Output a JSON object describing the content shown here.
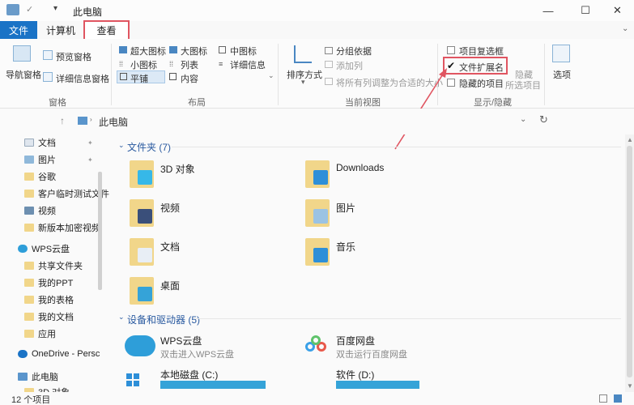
{
  "window": {
    "title": "此电脑",
    "minimize": "—",
    "maximize": "☐",
    "close": "✕"
  },
  "tabs": {
    "file": "文件",
    "computer": "计算机",
    "view": "查看"
  },
  "ribbon": {
    "nav_pane": "导航窗格",
    "preview_pane": "预览窗格",
    "details_pane": "详细信息窗格",
    "layout": {
      "extra_large": "超大图标",
      "large": "大图标",
      "medium": "中图标",
      "small": "小图标",
      "list": "列表",
      "details": "详细信息",
      "tiles": "平铺",
      "content": "内容"
    },
    "sort_by": "排序方式",
    "group_by": "分组依据",
    "add_columns": "添加列",
    "fit_columns": "将所有列调整为合适的大小",
    "show_hide": {
      "item_checkboxes": "项目复选框",
      "file_extensions": "文件扩展名",
      "hidden_items": "隐藏的项目",
      "hide_selected_1": "隐藏",
      "hide_selected_2": "所选项目",
      "file_ext_checked": true
    },
    "options": "选项",
    "groups": {
      "panes": "窗格",
      "layout": "布局",
      "current_view": "当前视图",
      "show_hide": "显示/隐藏"
    }
  },
  "address": {
    "path": "此电脑"
  },
  "nav": {
    "items": [
      {
        "label": "文档",
        "pinned": true
      },
      {
        "label": "图片",
        "pinned": true
      },
      {
        "label": "谷歌"
      },
      {
        "label": "客户临时测试文件"
      },
      {
        "label": "视频"
      },
      {
        "label": "新版本加密视频"
      },
      {
        "label": "WPS云盘"
      },
      {
        "label": "共享文件夹"
      },
      {
        "label": "我的PPT"
      },
      {
        "label": "我的表格"
      },
      {
        "label": "我的文档"
      },
      {
        "label": "应用"
      },
      {
        "label": "OneDrive - Persc"
      },
      {
        "label": "此电脑"
      },
      {
        "label": "3D 对象"
      }
    ]
  },
  "main": {
    "folders_header": "文件夹 (7)",
    "folders": [
      {
        "label": "3D 对象"
      },
      {
        "label": "Downloads"
      },
      {
        "label": "视频"
      },
      {
        "label": "图片"
      },
      {
        "label": "文档"
      },
      {
        "label": "音乐"
      },
      {
        "label": "桌面"
      }
    ],
    "devices_header": "设备和驱动器 (5)",
    "devices": [
      {
        "label": "WPS云盘",
        "sub": "双击进入WPS云盘"
      },
      {
        "label": "百度网盘",
        "sub": "双击运行百度网盘"
      },
      {
        "label": "本地磁盘 (C:)"
      },
      {
        "label": "软件 (D:)"
      }
    ]
  },
  "status": {
    "count": "12 个项目"
  },
  "colors": {
    "accent": "#1a73c6",
    "highlight": "#e05561",
    "folder": "#f1d68a"
  }
}
